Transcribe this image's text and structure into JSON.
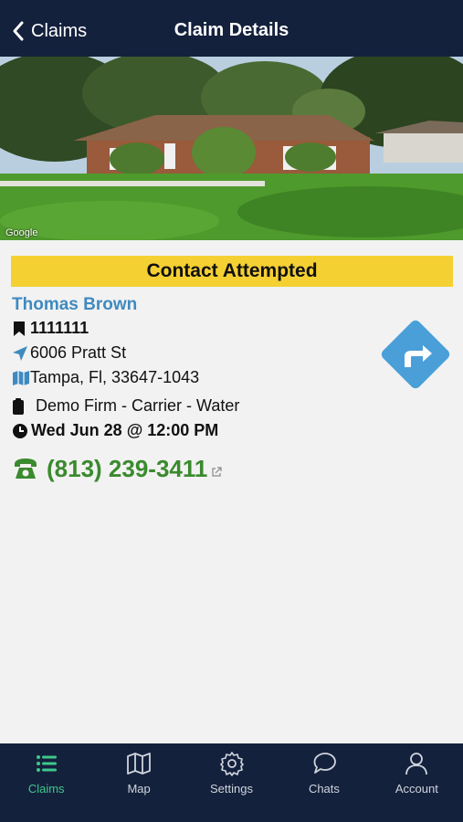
{
  "header": {
    "back_label": "Claims",
    "title": "Claim Details"
  },
  "photo": {
    "watermark": "Google"
  },
  "claim": {
    "status": "Contact Attempted",
    "insured_name": "Thomas Brown",
    "claim_number": "1111111",
    "street": "6006 Pratt St",
    "city_state_zip": "Tampa, Fl, 33647-1043",
    "firm": "Demo Firm - Carrier - Water",
    "appointment": "Wed Jun 28 @ 12:00 PM",
    "phone": "(813) 239-3411"
  },
  "tabs": [
    {
      "label": "Claims",
      "icon": "list-icon",
      "active": true
    },
    {
      "label": "Map",
      "icon": "map-icon",
      "active": false
    },
    {
      "label": "Settings",
      "icon": "gear-icon",
      "active": false
    },
    {
      "label": "Chats",
      "icon": "chat-bubble-icon",
      "active": false
    },
    {
      "label": "Account",
      "icon": "user-icon",
      "active": false
    }
  ],
  "colors": {
    "bar": "#14213d",
    "status_banner": "#f5d033",
    "name": "#3f8ac0",
    "phone": "#3a8a2e",
    "active_tab": "#3ec88a",
    "directions": "#4a9fd8"
  }
}
